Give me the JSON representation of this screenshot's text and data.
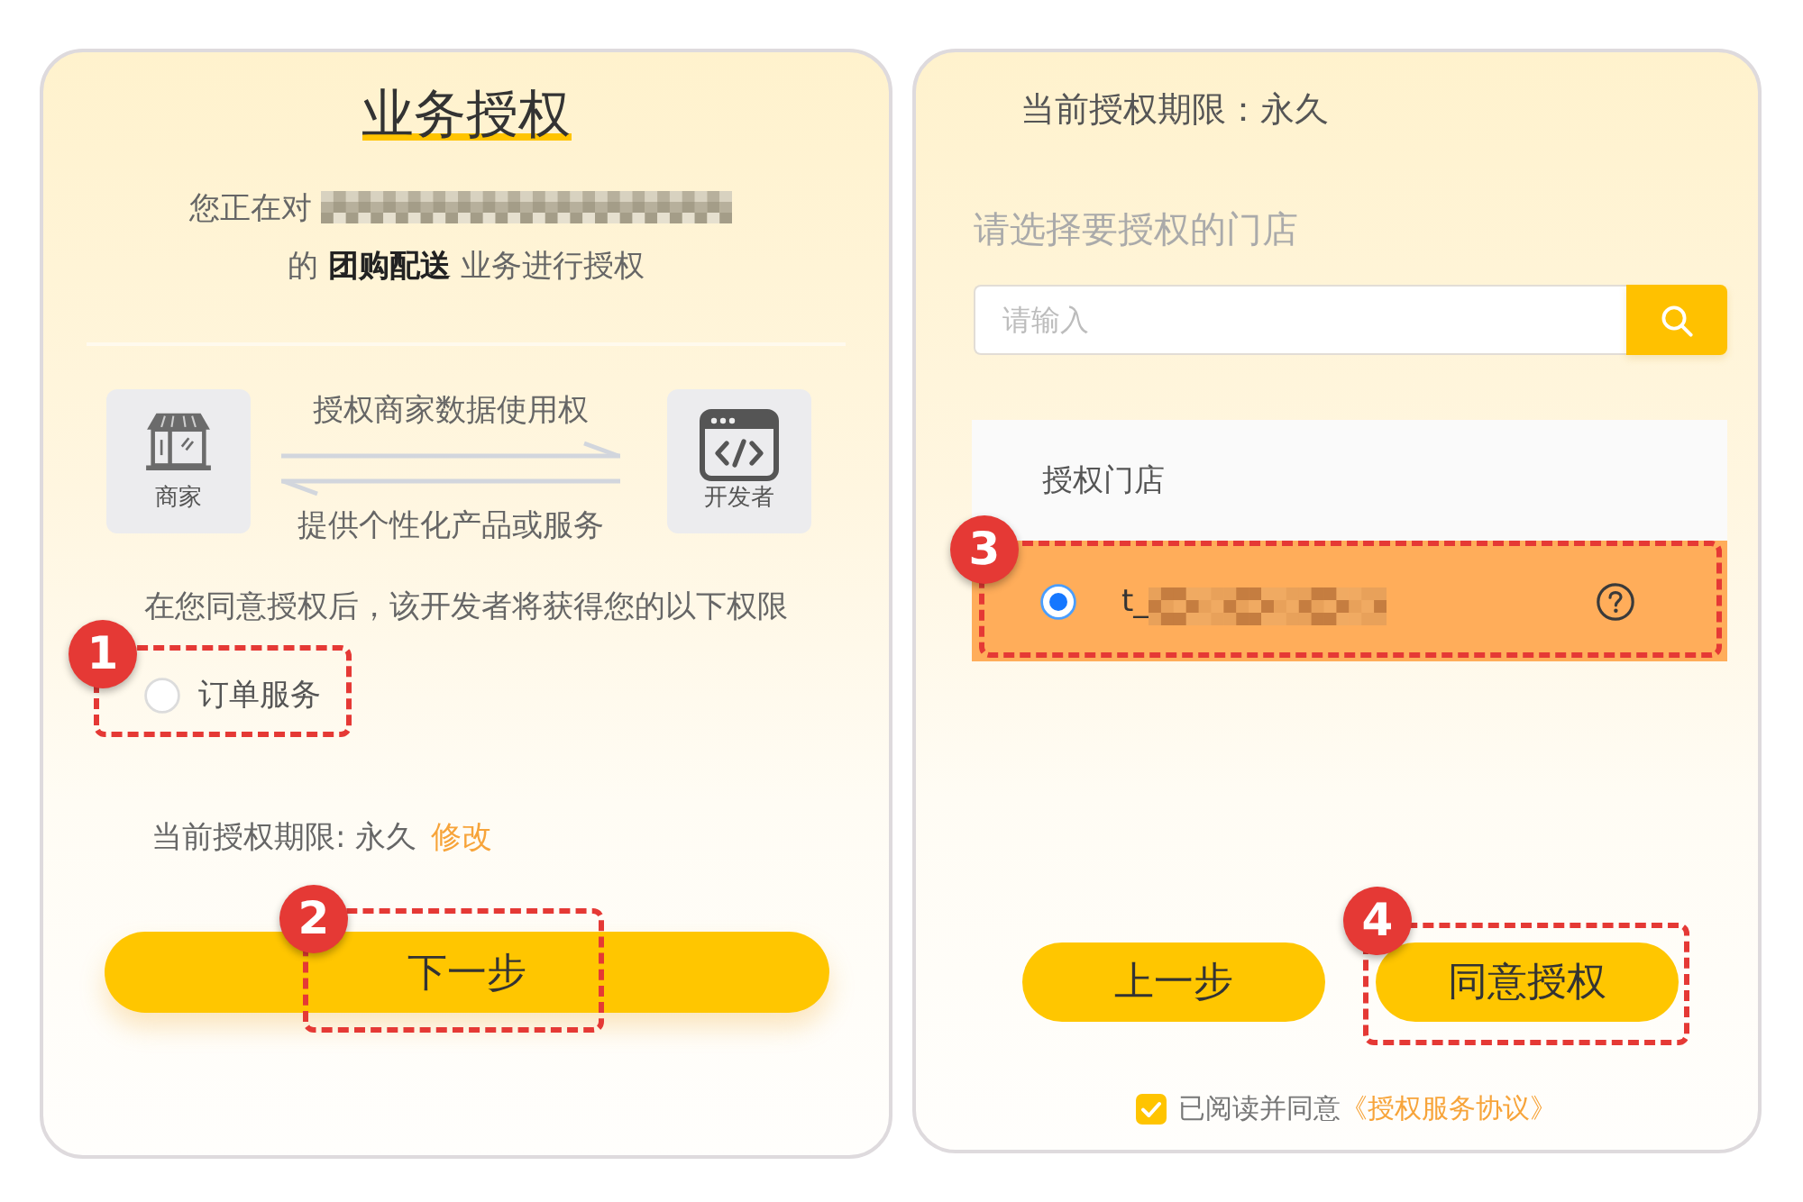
{
  "left_panel": {
    "title": "业务授权",
    "intro": {
      "prefix": "您正在对",
      "line_2": "的 **团购配送** 业务进行授权"
    },
    "diagram": {
      "merchant_label": "商家",
      "developer_label": "开发者",
      "top_label": "授权商家数据使用权",
      "bottom_label": "提供个性化产品或服务"
    },
    "permission_note": "在您同意授权后，该开发者将获得您的以下权限",
    "permissions": [
      {
        "label": "订单服务",
        "selected": false,
        "callout": "1"
      }
    ],
    "term": {
      "text": "当前授权期限: 永久",
      "link": "修改"
    },
    "next_button": {
      "label": "下一步",
      "callout": "2"
    }
  },
  "right_panel": {
    "term": "当前授权期限：永久",
    "store_prompt": "请选择要授权的门店",
    "search": {
      "placeholder": "请输入"
    },
    "store_table": {
      "columns": [
        "授权门店"
      ],
      "rows": [
        {
          "name": "t_",
          "selected": true,
          "callout": "3"
        }
      ]
    },
    "buttons": [
      {
        "label": "上一步"
      },
      {
        "label": "同意授权",
        "callout": "4"
      }
    ],
    "agreement": {
      "checked": true,
      "text": "已阅读并同意",
      "link": "《授权服务协议》"
    }
  }
}
